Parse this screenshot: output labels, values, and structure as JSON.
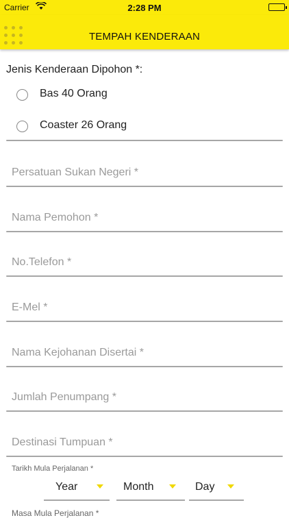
{
  "status_bar": {
    "carrier": "Carrier",
    "time": "2:28 PM",
    "icons": [
      "wifi-icon",
      "battery-icon"
    ]
  },
  "nav_bar": {
    "title": "TEMPAH KENDERAAN",
    "menu_icon": "grid-menu-icon"
  },
  "form": {
    "vehicle_question": "Jenis Kenderaan Dipohon *:",
    "vehicle_options": [
      "Bas 40 Orang",
      "Coaster 26 Orang"
    ],
    "fields": [
      {
        "placeholder": "Persatuan Sukan Negeri *",
        "value": ""
      },
      {
        "placeholder": "Nama Pemohon *",
        "value": ""
      },
      {
        "placeholder": "No.Telefon *",
        "value": ""
      },
      {
        "placeholder": "E-Mel *",
        "value": ""
      },
      {
        "placeholder": "Nama Kejohanan Disertai *",
        "value": ""
      },
      {
        "placeholder": "Jumlah Penumpang *",
        "value": ""
      },
      {
        "placeholder": "Destinasi Tumpuan *",
        "value": ""
      }
    ],
    "start_date_label": "Tarikh Mula Perjalanan *",
    "date_selects": [
      "Year",
      "Month",
      "Day"
    ],
    "next_label_partial": "Masa Mula Perjalanan *"
  },
  "colors": {
    "accent": "#fbea0a",
    "underline": "#a6a6a6",
    "placeholder": "#9a9a9a"
  }
}
